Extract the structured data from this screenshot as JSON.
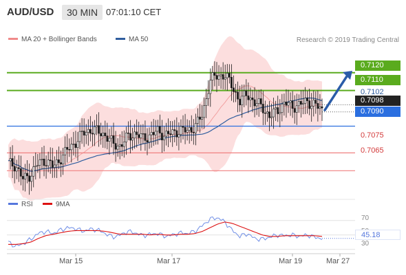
{
  "header": {
    "symbol": "AUD/USD",
    "timeframe": "30 MIN",
    "time": "07:01:10 CET"
  },
  "legend_top": {
    "items": [
      {
        "label": "MA 20 + Bollinger Bands",
        "color": "#f08a8a"
      },
      {
        "label": "MA 50",
        "color": "#2f5d9e"
      }
    ]
  },
  "credit": "Research © 2019 Trading Central",
  "legend_bottom": {
    "items": [
      {
        "label": "RSI",
        "color": "#5577dd"
      },
      {
        "label": "9MA",
        "color": "#dd1111"
      }
    ]
  },
  "colors": {
    "green_level": "#5aab1e",
    "blue_level": "#2b6fe0",
    "red_level": "#f08080",
    "bb_fill": "#fcdede",
    "candle": "#1a1a1a",
    "arrow": "#2a5ca8",
    "rsi": "#6f8ee6",
    "rsi_ma": "#dd1111"
  },
  "chart_data": [
    {
      "type": "candlestick",
      "title": "",
      "ylim": [
        0.7052,
        0.7133
      ],
      "price_levels": [
        {
          "value": "0.7120",
          "kind": "resistance"
        },
        {
          "value": "0.7110",
          "kind": "resistance"
        },
        {
          "value": "0.7102",
          "kind": "reference"
        },
        {
          "value": "0.7098",
          "kind": "last"
        },
        {
          "value": "0.7090",
          "kind": "pivot"
        },
        {
          "value": "0.7075",
          "kind": "support"
        },
        {
          "value": "0.7065",
          "kind": "support"
        }
      ],
      "x_ticks": [
        "Mar 15",
        "Mar 17",
        "Mar 19",
        "Mar 27"
      ],
      "series": [
        {
          "name": "MA 20 + Bollinger Bands",
          "role": "bollinger"
        },
        {
          "name": "MA 50",
          "role": "ma"
        }
      ],
      "close_path": [
        0.7069,
        0.7068,
        0.706,
        0.7063,
        0.7069,
        0.7071,
        0.7067,
        0.7072,
        0.7077,
        0.7081,
        0.7086,
        0.7088,
        0.7087,
        0.7085,
        0.708,
        0.7079,
        0.7084,
        0.7086,
        0.7083,
        0.7085,
        0.7087,
        0.7085,
        0.7086,
        0.7088,
        0.7087,
        0.709,
        0.7096,
        0.7116,
        0.7118,
        0.7119,
        0.7112,
        0.7104,
        0.7108,
        0.7103,
        0.7101,
        0.7095,
        0.7099,
        0.7103,
        0.7101,
        0.7102,
        0.7104,
        0.7102,
        0.7099
      ],
      "annotation": "arrow pointing up toward 0.7120"
    },
    {
      "type": "line",
      "title": "",
      "ylim": [
        25,
        85
      ],
      "y_ticks": [
        "70",
        "50",
        "30"
      ],
      "series": [
        {
          "name": "RSI"
        },
        {
          "name": "9MA"
        }
      ],
      "last_value": "45.18",
      "rsi_path": [
        40,
        34,
        38,
        44,
        52,
        55,
        52,
        57,
        60,
        59,
        55,
        58,
        57,
        52,
        47,
        50,
        55,
        53,
        49,
        51,
        52,
        48,
        50,
        53,
        52,
        55,
        63,
        72,
        74,
        68,
        56,
        48,
        52,
        45,
        44,
        47,
        50,
        49,
        50,
        48,
        50,
        47,
        45
      ],
      "ma_path": [
        37,
        37,
        38,
        40,
        45,
        49,
        51,
        53,
        55,
        56,
        56,
        56,
        56,
        55,
        53,
        51,
        51,
        51,
        51,
        50,
        51,
        50,
        50,
        51,
        51,
        52,
        55,
        60,
        65,
        68,
        66,
        62,
        58,
        54,
        50,
        48,
        48,
        49,
        49,
        49,
        49,
        49,
        48
      ]
    }
  ]
}
